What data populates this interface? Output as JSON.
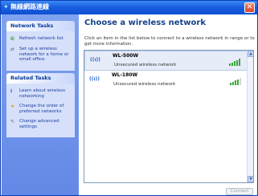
{
  "window": {
    "title": "無線網路連線",
    "title_icon": "network-icon",
    "close_glyph": "✕"
  },
  "sidebar": {
    "network_tasks": {
      "heading": "Network Tasks",
      "items": [
        {
          "label": "Refresh network list",
          "icon": "refresh-icon",
          "glyph": "❂"
        },
        {
          "label": "Set up a wireless network for a home or small office",
          "icon": "setup-icon",
          "glyph": "⇄"
        }
      ]
    },
    "related_tasks": {
      "heading": "Related Tasks",
      "items": [
        {
          "label": "Learn about wireless networking",
          "icon": "info-icon",
          "glyph": "ℹ"
        },
        {
          "label": "Change the order of preferred networks",
          "icon": "star-icon",
          "glyph": "★"
        },
        {
          "label": "Change advanced settings",
          "icon": "settings-icon",
          "glyph": "✎"
        }
      ]
    }
  },
  "main": {
    "title": "Choose a wireless network",
    "instructions": "Click an item in the list below to connect to a wireless network in range or to get more information.",
    "networks": [
      {
        "name": "WL-500W",
        "security": "Unsecured wireless network",
        "signal_bars": 5,
        "icon": "wifi-antenna-icon",
        "glyph": "((ı))"
      },
      {
        "name": "WL-180W",
        "security": "Unsecured wireless network",
        "signal_bars": 4,
        "icon": "wifi-antenna-icon",
        "glyph": "((ı))"
      }
    ],
    "connect_label": "Connect"
  },
  "colors": {
    "titlebar": "#1a5fe0",
    "sidebar": "#7fa2f0",
    "title_text": "#15428b",
    "signal": "#3aa53a"
  }
}
